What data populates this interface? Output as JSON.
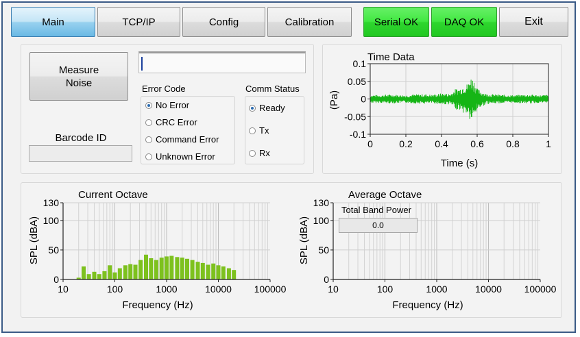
{
  "tabs": [
    "Main",
    "TCP/IP",
    "Config",
    "Calibration"
  ],
  "status": {
    "serial": "Serial OK",
    "daq": "DAQ OK"
  },
  "exit_label": "Exit",
  "measure": {
    "line1": "Measure",
    "line2": "Noise"
  },
  "barcode": {
    "label": "Barcode ID",
    "value": ""
  },
  "error_code": {
    "title": "Error Code",
    "options": [
      "No Error",
      "CRC Error",
      "Command Error",
      "Unknown Error"
    ],
    "selected": 0
  },
  "comm_status": {
    "title": "Comm Status",
    "options": [
      "Ready",
      "Tx",
      "Rx"
    ],
    "selected": 0
  },
  "colors": {
    "bar": "#7dc11e",
    "trace": "#15b515",
    "accent_green": "#2ed62e",
    "active_tab": "#98d1ef"
  },
  "chart_data": [
    {
      "type": "line",
      "title": "Time Data",
      "xlabel": "Time (s)",
      "ylabel": "(Pa)",
      "xlim": [
        0,
        1
      ],
      "ylim": [
        -0.1,
        0.1
      ],
      "xticks": [
        "0",
        "0.2",
        "0.4",
        "0.6",
        "0.8",
        "1"
      ],
      "yticks": [
        "0.1",
        "0.05",
        "0",
        "-0.05",
        "-0.1"
      ],
      "grid": true,
      "series": [
        {
          "x": [
            0,
            0.05,
            0.1,
            0.15,
            0.2,
            0.25,
            0.3,
            0.35,
            0.4,
            0.45,
            0.48,
            0.5,
            0.52,
            0.55,
            0.56,
            0.58,
            0.6,
            0.65,
            0.7,
            0.75,
            0.8,
            0.85,
            0.9,
            0.95,
            1.0
          ],
          "y": [
            0.012,
            -0.011,
            0.013,
            -0.012,
            0.011,
            -0.013,
            0.014,
            -0.012,
            0.016,
            -0.015,
            0.03,
            -0.03,
            0.04,
            -0.045,
            0.065,
            -0.06,
            0.03,
            -0.015,
            0.013,
            -0.012,
            0.011,
            -0.012,
            0.013,
            -0.011,
            0.012
          ]
        }
      ]
    },
    {
      "type": "bar",
      "title": "Current Octave",
      "xlabel": "Frequency (Hz)",
      "ylabel": "SPL (dBA)",
      "xscale": "log",
      "xlim": [
        10,
        100000
      ],
      "ylim": [
        0,
        130
      ],
      "xticks": [
        "10",
        "100",
        "1000",
        "10000",
        "100000"
      ],
      "yticks": [
        "130",
        "100",
        "50",
        "0"
      ],
      "grid": true,
      "bands_hz": [
        20,
        25,
        31.5,
        40,
        50,
        63,
        80,
        100,
        125,
        160,
        200,
        250,
        315,
        400,
        500,
        630,
        800,
        1000,
        1250,
        1600,
        2000,
        2500,
        3150,
        4000,
        5000,
        6300,
        8000,
        10000,
        12500,
        16000,
        20000
      ],
      "values": [
        3,
        22,
        9,
        13,
        9,
        14,
        24,
        12,
        19,
        24,
        26,
        25,
        33,
        42,
        36,
        33,
        37,
        39,
        40,
        38,
        37,
        35,
        33,
        30,
        28,
        25,
        27,
        24,
        22,
        19,
        16
      ]
    },
    {
      "type": "bar",
      "title": "Average Octave",
      "xlabel": "Frequency (Hz)",
      "ylabel": "SPL (dBA)",
      "xscale": "log",
      "xlim": [
        10,
        100000
      ],
      "ylim": [
        0,
        130
      ],
      "xticks": [
        "10",
        "100",
        "1000",
        "10000",
        "100000"
      ],
      "yticks": [
        "130",
        "100",
        "50",
        "0"
      ],
      "grid": true,
      "values": [],
      "total_band_power": {
        "label": "Total Band Power",
        "value": "0.0"
      }
    }
  ]
}
